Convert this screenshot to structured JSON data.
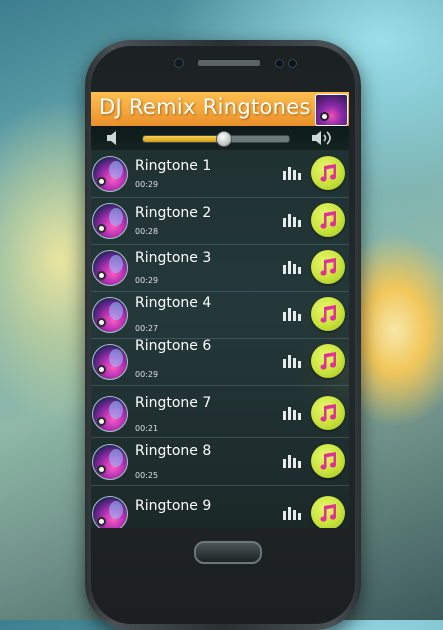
{
  "app": {
    "title": "DJ Remix Ringtones",
    "icon": "dj-app-icon"
  },
  "volume": {
    "level": 0.55,
    "left_icon": "volume-low-icon",
    "right_icon": "volume-high-icon"
  },
  "colors": {
    "title_bar": "#f4a63a",
    "play_button": "#c8e33a",
    "music_note": "#e0309a",
    "slider_fill": "#f0c040"
  },
  "ringtones": [
    {
      "name": "Ringtone 1",
      "duration": "00:29"
    },
    {
      "name": "Ringtone 2",
      "duration": "00:28"
    },
    {
      "name": "Ringtone 3",
      "duration": "00:29"
    },
    {
      "name": "Ringtone 4",
      "duration": "00:27"
    },
    {
      "name": "Ringtone 6",
      "duration": "00:29"
    },
    {
      "name": "Ringtone 7",
      "duration": "00:21"
    },
    {
      "name": "Ringtone 8",
      "duration": "00:25"
    },
    {
      "name": "Ringtone 9",
      "duration": ""
    }
  ],
  "icons": {
    "row_eq": "equalizer-icon",
    "row_play": "music-note-icon"
  }
}
